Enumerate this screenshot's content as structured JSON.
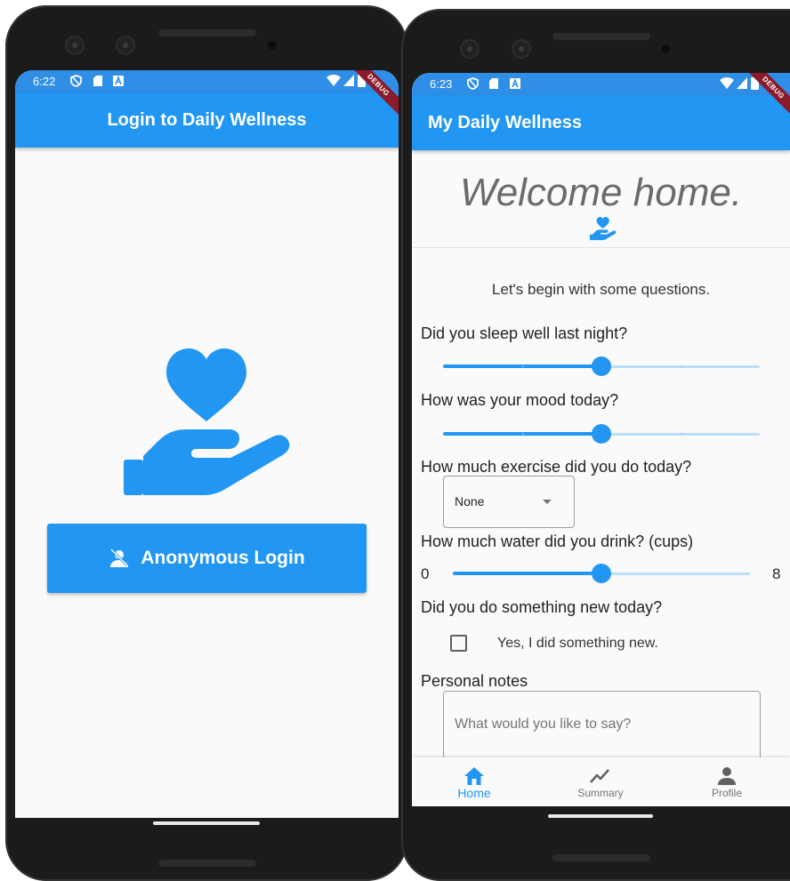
{
  "colors": {
    "primary": "#2196f3",
    "primary_light": "#bbdefb",
    "status_bar": "#2f8ee6"
  },
  "login_screen": {
    "status_time": "6:22",
    "debug_banner": "DEBUG",
    "title": "Login to Daily Wellness",
    "login_button_label": "Anonymous Login",
    "icons": [
      "volunteer-activism-icon",
      "no-accounts-icon"
    ]
  },
  "home_screen": {
    "status_time": "6:23",
    "debug_banner": "DEBUG",
    "title": "My Daily Wellness",
    "welcome": "Welcome home.",
    "intro": "Let's begin with some questions.",
    "questions": {
      "sleep": {
        "label": "Did you sleep well last night?",
        "value": 0.5
      },
      "mood": {
        "label": "How was your mood today?",
        "value": 0.5
      },
      "exercise": {
        "label": "How much exercise did you do today?",
        "selected": "None"
      },
      "water": {
        "label": "How much water did you drink? (cups)",
        "min": "0",
        "max": "8",
        "value": 4
      },
      "new_thing": {
        "label": "Did you do something new today?",
        "checkbox_label": "Yes, I did something new.",
        "checked": false
      },
      "notes": {
        "label": "Personal notes",
        "placeholder": "What would you like to say?"
      }
    },
    "bottom_nav": [
      {
        "label": "Home",
        "icon": "home-icon",
        "active": true
      },
      {
        "label": "Summary",
        "icon": "show-chart-icon",
        "active": false
      },
      {
        "label": "Profile",
        "icon": "person-icon",
        "active": false
      }
    ]
  }
}
